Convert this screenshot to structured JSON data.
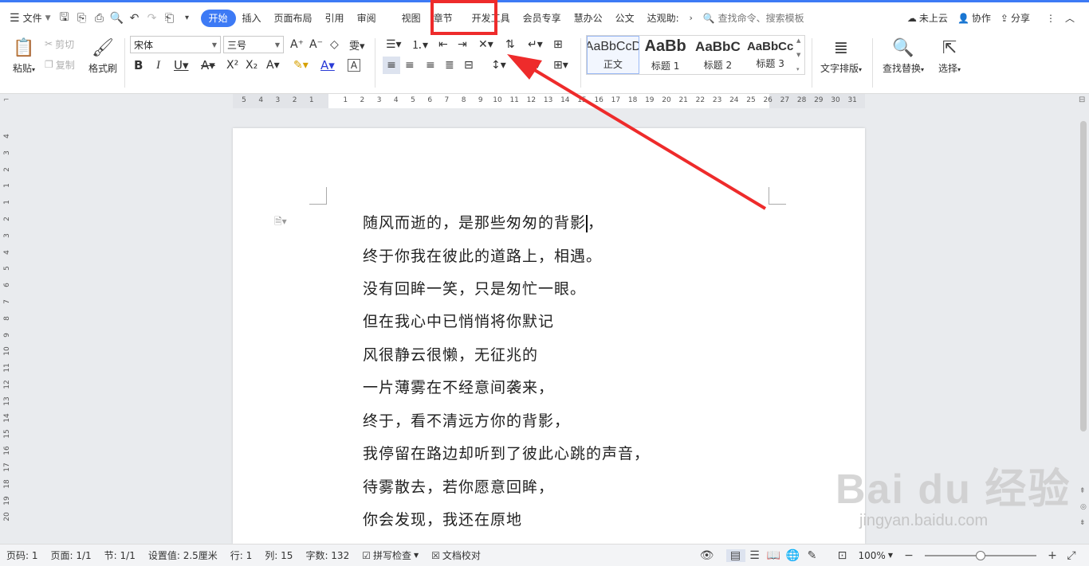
{
  "menubar": {
    "file_label": "文件",
    "tabs": [
      {
        "label": "开始",
        "active": true
      },
      {
        "label": "插入"
      },
      {
        "label": "页面布局"
      },
      {
        "label": "引用"
      },
      {
        "label": "审阅"
      },
      {
        "label": "视图"
      },
      {
        "label": "章节"
      },
      {
        "label": "开发工具"
      },
      {
        "label": "会员专享"
      },
      {
        "label": "慧办公"
      },
      {
        "label": "公文"
      },
      {
        "label": "达观助:"
      }
    ],
    "search_placeholder": "查找命令、搜索模板",
    "cloud_label": "未上云",
    "collab_label": "协作",
    "share_label": "分享"
  },
  "ribbon": {
    "paste_label": "粘贴",
    "cut_label": "剪切",
    "copy_label": "复制",
    "format_painter_label": "格式刷",
    "font_name": "宋体",
    "font_size": "三号",
    "styles": [
      {
        "sample": "AaBbCcD",
        "name": "正文"
      },
      {
        "sample": "AaBb",
        "name": "标题 1"
      },
      {
        "sample": "AaBbC",
        "name": "标题 2"
      },
      {
        "sample": "AaBbCc",
        "name": "标题 3"
      }
    ],
    "text_layout_label": "文字排版",
    "find_replace_label": "查找替换",
    "select_label": "选择"
  },
  "ruler": {
    "h_left": [
      "5",
      "4",
      "3",
      "2",
      "1"
    ],
    "h_right": [
      "1",
      "2",
      "3",
      "4",
      "5",
      "6",
      "7",
      "8",
      "9",
      "10",
      "11",
      "12",
      "13",
      "14",
      "15",
      "16",
      "17",
      "18",
      "19",
      "20",
      "21",
      "22",
      "23",
      "24",
      "25",
      "26",
      "27",
      "28",
      "29",
      "30",
      "31"
    ],
    "v": [
      "4",
      "3",
      "2",
      "1",
      "1",
      "2",
      "3",
      "4",
      "5",
      "6",
      "7",
      "8",
      "9",
      "10",
      "11",
      "12",
      "13",
      "14",
      "15",
      "16",
      "17",
      "18",
      "19",
      "20"
    ]
  },
  "document": {
    "paragraphs": [
      "随风而逝的，是那些匆匆的背影",
      "终于你我在彼此的道路上，相遇。",
      "没有回眸一笑，只是匆忙一眼。",
      "但在我心中已悄悄将你默记",
      "风很静云很懒，无征兆的",
      "一片薄雾在不经意间袭来，",
      "终于，看不清远方你的背影，",
      "我停留在路边却听到了彼此心跳的声音，",
      "待雾散去，若你愿意回眸，",
      "你会发现，我还在原地"
    ],
    "first_para_tail": "，"
  },
  "statusbar": {
    "page_code": "页码: 1",
    "pages": "页面: 1/1",
    "section": "节: 1/1",
    "setting": "设置值: 2.5厘米",
    "row": "行: 1",
    "col": "列: 15",
    "word_count": "字数: 132",
    "spell_check": "拼写检查",
    "doc_proof": "文档校对",
    "zoom": "100%",
    "zoom_fraction": 0.5
  },
  "watermark": {
    "logo": "Bai du 经验",
    "url": "jingyan.baidu.com"
  },
  "colors": {
    "accent": "#3d7af5",
    "annotation": "#ee2b2b"
  }
}
